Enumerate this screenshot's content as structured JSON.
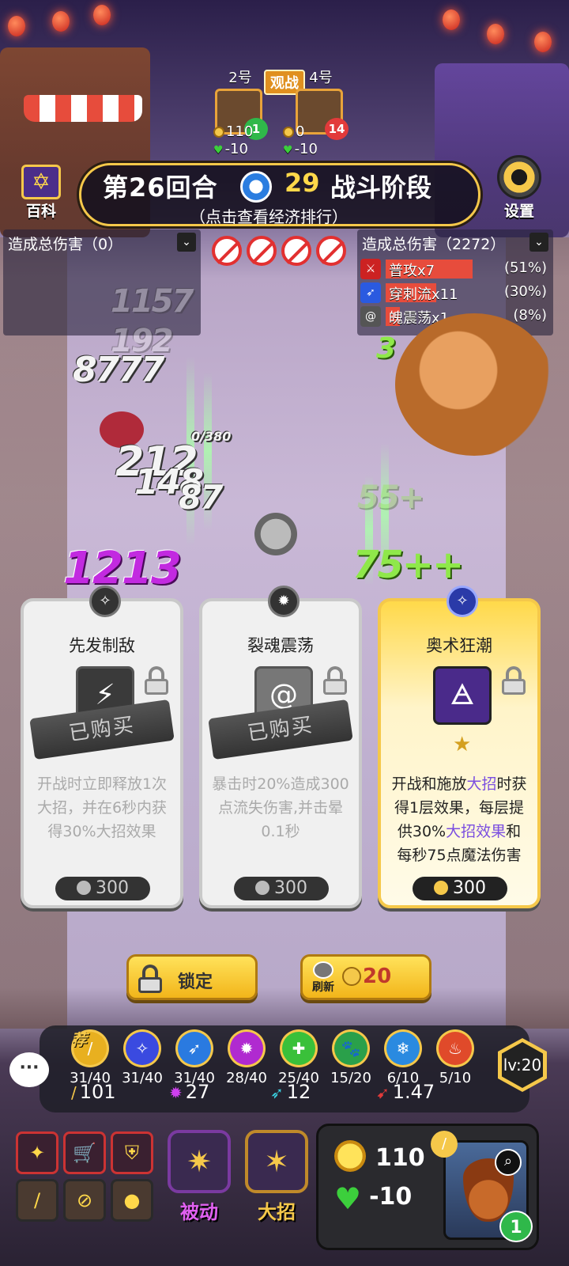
{
  "header": {
    "round": "第26回合",
    "timer": "29",
    "phase": "战斗阶段",
    "econ_hint": "（点击查看经济排行）",
    "baike_label": "百科",
    "settings_label": "设置"
  },
  "spectate": {
    "badge": "观战",
    "players": [
      {
        "label": "2号",
        "hearts": "1",
        "gold": "110",
        "hp_change": "-10"
      },
      {
        "label": "4号",
        "hearts": "14",
        "gold": "0",
        "hp_change": "-10"
      }
    ]
  },
  "damage_left": {
    "title": "造成总伤害（0）"
  },
  "damage_right": {
    "title": "造成总伤害（2272）",
    "rows": [
      {
        "name": "普攻x7",
        "pct": "(51%)"
      },
      {
        "name": "穿刺流x11",
        "pct": "(30%)"
      },
      {
        "name": "魄震荡x1",
        "pct": "(8%)"
      }
    ]
  },
  "battle_numbers": {
    "n1": "1157",
    "n2": "192",
    "n3": "8777",
    "n4": "212",
    "n5": "148",
    "n6": "87",
    "n7": "1213",
    "n8": "75++",
    "n9": "0/380",
    "n10": "55+",
    "n11": "3"
  },
  "shop": {
    "cards": [
      {
        "title": "先发制敌",
        "purchased": "已购买",
        "desc": "开战时立即释放1次大招，并在6秒内获得30%大招效果",
        "price": "300"
      },
      {
        "title": "裂魂震荡",
        "purchased": "已购买",
        "desc": "暴击时20%造成300点流失伤害,并击晕0.1秒",
        "price": "300"
      },
      {
        "title": "奥术狂潮",
        "desc_a": "开战和施放",
        "desc_hl1": "大招",
        "desc_b": "时获得1层效果，每层提供30%",
        "desc_hl2": "大招效果",
        "desc_c": "和每秒75点魔法伤害",
        "price": "300"
      }
    ],
    "lock_label": "锁定",
    "refresh_label": "刷新",
    "refresh_cost": "20"
  },
  "synergies": {
    "rec_tag": "荐",
    "items": [
      {
        "icon": "sword-icon",
        "count": "31/40",
        "color": "#e8b020"
      },
      {
        "icon": "arcane-icon",
        "count": "31/40",
        "color": "#3a4ae0"
      },
      {
        "icon": "pierce-icon",
        "count": "31/40",
        "color": "#2a7ae0"
      },
      {
        "icon": "burst-icon",
        "count": "28/40",
        "color": "#b02ad0"
      },
      {
        "icon": "heal-icon",
        "count": "25/40",
        "color": "#3ac03a"
      },
      {
        "icon": "paw-icon",
        "count": "15/20",
        "color": "#2aa04a"
      },
      {
        "icon": "frost-icon",
        "count": "6/10",
        "color": "#2a8ae0"
      },
      {
        "icon": "fire-icon",
        "count": "5/10",
        "color": "#e04a2a"
      }
    ],
    "stats": {
      "attack": "101",
      "burst": "27",
      "pierce": "12",
      "speed": "1.47"
    },
    "level": "lv:20"
  },
  "bottom": {
    "passive_label": "被动",
    "ultimate_label": "大招",
    "gold": "110",
    "hp_change": "-10",
    "hero_hearts": "1"
  }
}
